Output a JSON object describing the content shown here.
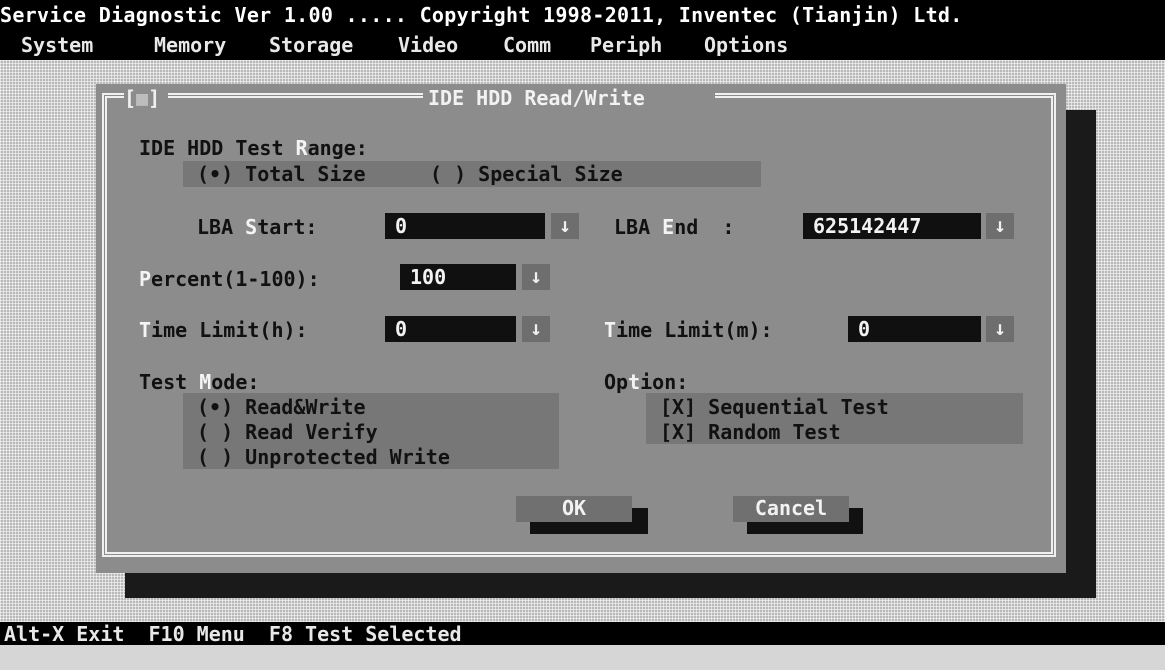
{
  "app": {
    "title": "Service Diagnostic Ver 1.00 ..... Copyright 1998-2011, Inventec (Tianjin) Ltd."
  },
  "menu": [
    "System",
    "Memory",
    "Storage",
    "Video",
    "Comm",
    "Periph",
    "Options"
  ],
  "dialog": {
    "title": "IDE HDD Read/Write",
    "close": {
      "open": "[",
      "mark": "■",
      "close": "]"
    },
    "range": {
      "label_pre": "IDE HDD Test ",
      "label_hot": "R",
      "label_post": "ange:",
      "opt_total": "(•) Total Size",
      "opt_special": "( ) Special Size"
    },
    "lba_start": {
      "pre": "LBA ",
      "hot": "S",
      "post": "tart:",
      "value": "0"
    },
    "lba_end": {
      "pre": "LBA ",
      "hot": "E",
      "post": "nd  :",
      "value": "625142447"
    },
    "percent": {
      "hot": "P",
      "post": "ercent(1-100):",
      "value": "100"
    },
    "time_h": {
      "hot": "T",
      "post": "ime Limit(h):",
      "value": "0"
    },
    "time_m": {
      "hot": "T",
      "post": "ime Limit(m):",
      "value": "0"
    },
    "arrow": "↓",
    "mode": {
      "label_pre": "Test ",
      "label_hot": "M",
      "label_post": "ode:",
      "items": [
        "(•) Read&Write",
        "( ) Read Verify",
        "( ) Unprotected Write"
      ]
    },
    "option": {
      "label_pre": "Op",
      "label_hot": "t",
      "label_post": "ion:",
      "items": [
        "[X] Sequential Test",
        "[X] Random Test"
      ]
    },
    "ok_label": "OK",
    "cancel_label": "Cancel"
  },
  "status": "Alt-X Exit  F10 Menu  F8 Test Selected"
}
